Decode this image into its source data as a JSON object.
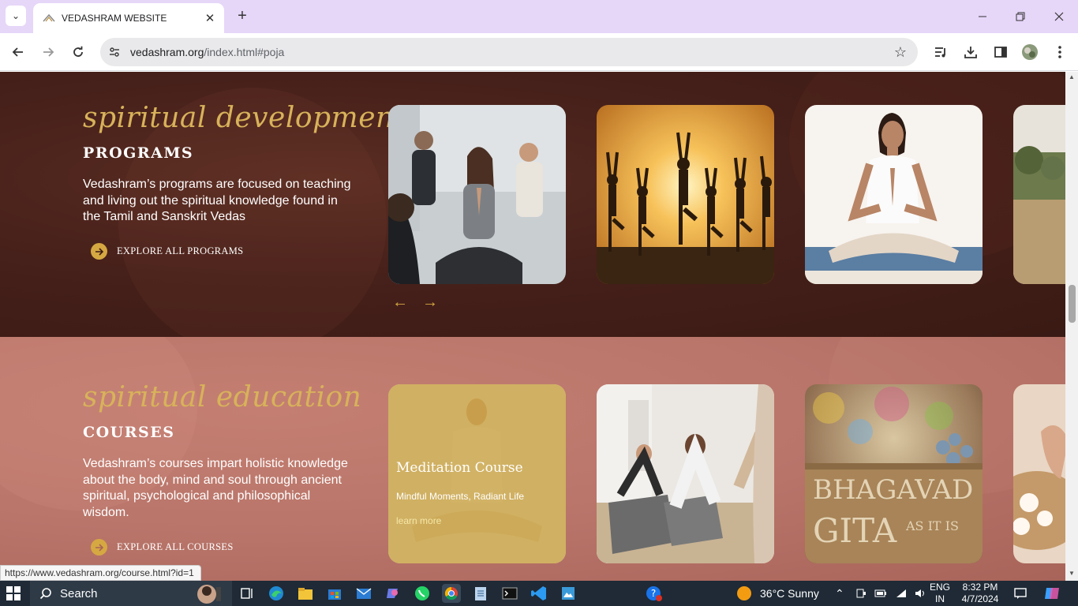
{
  "browser": {
    "tab_title": "VEDASHRAM WEBSITE",
    "url_domain": "vedashram.org",
    "url_path": "/index.html#poja",
    "status_url": "https://www.vedashram.org/course.html?id=1"
  },
  "programs": {
    "script_title": "spiritual development",
    "heading": "PROGRAMS",
    "description": "Vedashram’s programs are focused on teaching and living out the spiritual knowledge found in the Tamil and Sanskrit Vedas",
    "explore_label": "EXPLORE ALL PROGRAMS",
    "prev_label": "←",
    "next_label": "→"
  },
  "courses": {
    "script_title": "spiritual education",
    "heading": "COURSES",
    "description": "Vedashram’s courses impart holistic knowledge about the body, mind and soul through ancient spiritual, psychological and philosophical wisdom.",
    "explore_label": "EXPLORE ALL COURSES",
    "cards": [
      {
        "title": "Meditation Course",
        "subtitle": "Mindful Moments, Radiant Life",
        "link": "learn more"
      },
      {
        "title": "",
        "subtitle": "",
        "link": ""
      },
      {
        "title": "",
        "subtitle": "",
        "link": "",
        "image_text_1": "BHAGAVAD",
        "image_text_2": "GITA",
        "image_text_3": "AS IT IS"
      }
    ]
  },
  "taskbar": {
    "search_label": "Search",
    "weather": "36°C  Sunny",
    "lang_1": "ENG",
    "lang_2": "IN",
    "time": "8:32 PM",
    "date": "4/7/2024"
  }
}
